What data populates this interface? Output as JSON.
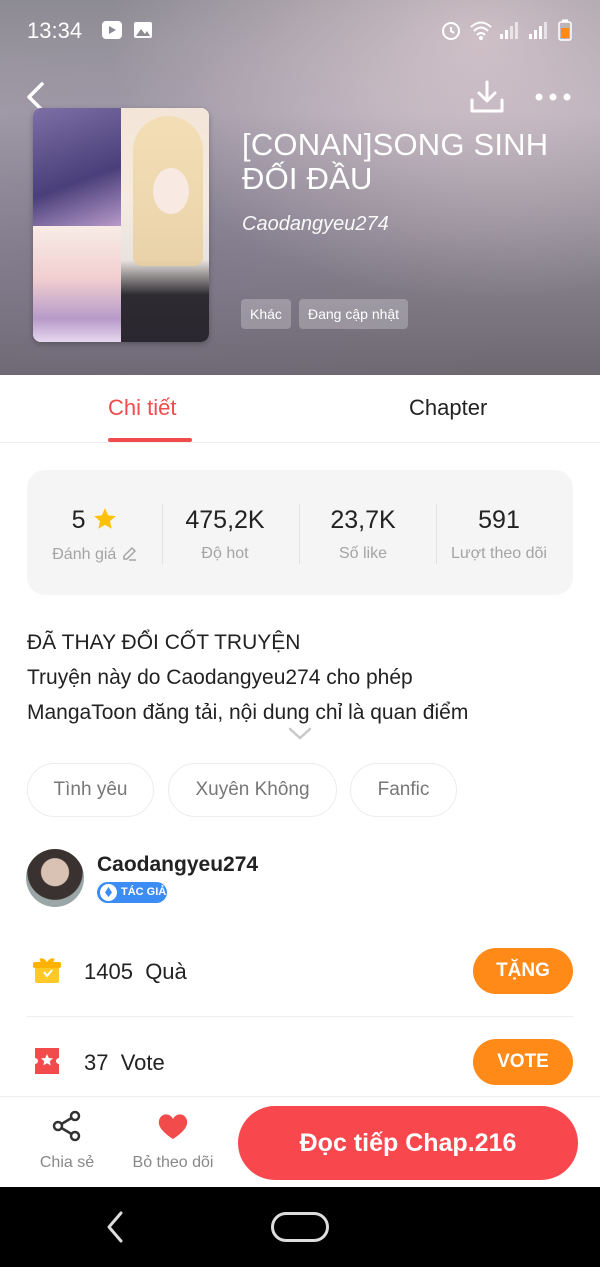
{
  "status_bar": {
    "time": "13:34"
  },
  "book": {
    "title": "[CONAN]SONG SINH ĐỐI ĐẦU",
    "author": "Caodangyeu274",
    "chips": [
      "Khác",
      "Đang cập nhật"
    ]
  },
  "tabs": {
    "detail": "Chi tiết",
    "chapter": "Chapter"
  },
  "stats": [
    {
      "value": "5",
      "label": "Đánh giá"
    },
    {
      "value": "475,2K",
      "label": "Độ hot"
    },
    {
      "value": "23,7K",
      "label": "Số like"
    },
    {
      "value": "591",
      "label": "Lượt theo dõi"
    }
  ],
  "description": {
    "line1": "ĐÃ THAY ĐỔI CỐT TRUYỆN",
    "line2": "Truyện này do Caodangyeu274 cho phép",
    "line3": "MangaToon đăng tải, nội dung chỉ là quan điểm"
  },
  "genres": [
    "Tình yêu",
    "Xuyên Không",
    "Fanfic"
  ],
  "author": {
    "name": "Caodangyeu274",
    "badge": "TÁC GIẢ"
  },
  "gifts": {
    "count": "1405",
    "unit": "Quà",
    "button": "TẶNG"
  },
  "votes": {
    "count": "37",
    "unit": "Vote",
    "button": "VOTE"
  },
  "bottom_bar": {
    "share": "Chia sẻ",
    "unfollow": "Bỏ theo dõi",
    "continue": "Đọc tiếp Chap.216"
  },
  "colors": {
    "accent": "#f24b4b",
    "button_orange": "#ff8a18",
    "read_button": "#f8474d",
    "badge_blue": "#3b8df5"
  }
}
